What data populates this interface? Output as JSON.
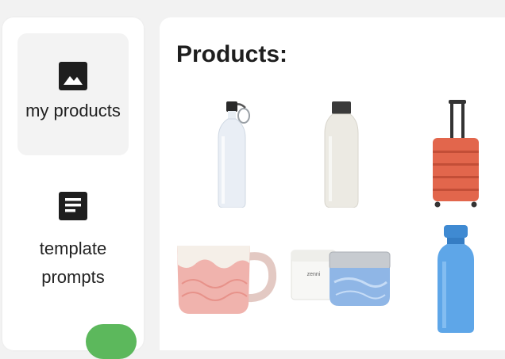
{
  "sidebar": {
    "items": [
      {
        "label": "my products",
        "icon": "image-icon",
        "active": true
      },
      {
        "label": "template prompts",
        "icon": "document-icon",
        "active": false
      }
    ]
  },
  "main": {
    "title": "Products:",
    "products": [
      {
        "icon": "white-water-bottle-with-carabiner"
      },
      {
        "icon": "white-insulated-bottle"
      },
      {
        "icon": "orange-suitcase"
      },
      {
        "icon": "pink-ceramic-mug"
      },
      {
        "icon": "white-and-blue-cosmetic-jars"
      },
      {
        "icon": "blue-water-bottle"
      }
    ]
  },
  "colors": {
    "accent_green": "#5cb85c",
    "active_nav_bg": "#f3f3f3",
    "page_bg": "#f2f2f2"
  }
}
